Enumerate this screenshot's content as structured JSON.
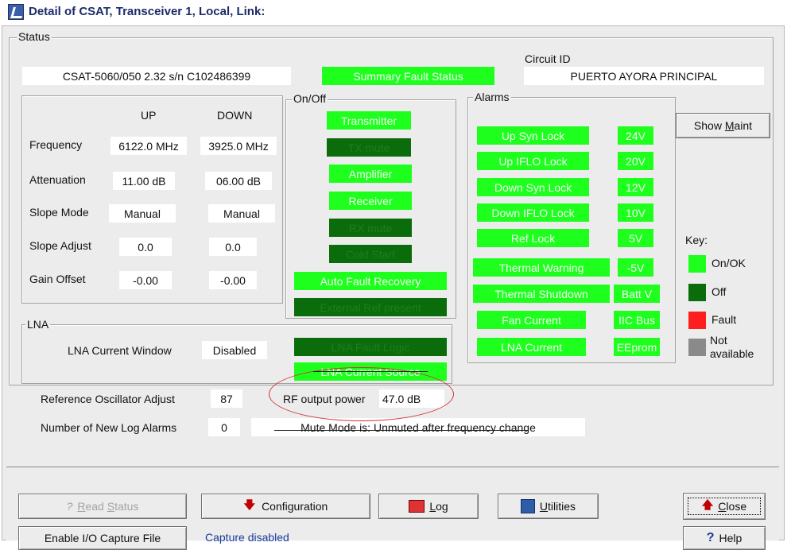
{
  "window": {
    "title": "Detail of CSAT,  Transceiver 1, Local, Link:"
  },
  "status": {
    "group_label": "Status",
    "device_info": "CSAT-5060/050  2.32   s/n C102486399",
    "summary_fault": "Summary Fault Status",
    "circuit_id_label": "Circuit ID",
    "circuit_id": "PUERTO AYORA PRINCIPAL"
  },
  "freq_table": {
    "col_up": "UP",
    "col_down": "DOWN",
    "rows": [
      {
        "label": "Frequency",
        "up": "6122.0 MHz",
        "down": "3925.0 MHz"
      },
      {
        "label": "Attenuation",
        "up": "11.00 dB",
        "down": "06.00 dB"
      },
      {
        "label": "Slope Mode",
        "up": "Manual",
        "down": "Manual"
      },
      {
        "label": "Slope Adjust",
        "up": "0.0",
        "down": "0.0"
      },
      {
        "label": "Gain Offset",
        "up": "-0.00",
        "down": "-0.00"
      }
    ]
  },
  "onoff": {
    "group_label": "On/Off",
    "items": [
      {
        "label": "Transmitter",
        "state": "on"
      },
      {
        "label": "TX mute",
        "state": "off"
      },
      {
        "label": "Amplifier",
        "state": "on"
      },
      {
        "label": "Receiver",
        "state": "on"
      },
      {
        "label": "RX mute",
        "state": "off"
      },
      {
        "label": "Cold Start",
        "state": "off"
      },
      {
        "label": "Auto Fault Recovery",
        "state": "on"
      },
      {
        "label": "External Ref present",
        "state": "off"
      }
    ]
  },
  "alarms": {
    "group_label": "Alarms",
    "left": [
      {
        "label": "Up Syn Lock",
        "state": "on"
      },
      {
        "label": "Up IFLO Lock",
        "state": "on"
      },
      {
        "label": "Down Syn Lock",
        "state": "on"
      },
      {
        "label": "Down IFLO Lock",
        "state": "on"
      },
      {
        "label": "Ref Lock",
        "state": "on"
      },
      {
        "label": "Thermal Warning",
        "state": "on"
      },
      {
        "label": "Thermal Shutdown",
        "state": "on"
      },
      {
        "label": "Fan Current",
        "state": "on"
      },
      {
        "label": "LNA Current",
        "state": "on"
      }
    ],
    "right": [
      {
        "label": "24V",
        "state": "on"
      },
      {
        "label": "20V",
        "state": "on"
      },
      {
        "label": "12V",
        "state": "on"
      },
      {
        "label": "10V",
        "state": "on"
      },
      {
        "label": "5V",
        "state": "on"
      },
      {
        "label": "-5V",
        "state": "on"
      },
      {
        "label": "Batt V",
        "state": "on"
      },
      {
        "label": "IIC Bus",
        "state": "on"
      },
      {
        "label": "EEprom",
        "state": "on"
      }
    ]
  },
  "show_maint": {
    "pre": "Show ",
    "ul": "M",
    "post": "aint"
  },
  "key": {
    "title": "Key:",
    "items": [
      {
        "label": "On/OK",
        "color": "#1eff1e"
      },
      {
        "label": "Off",
        "color": "#0a6c0a"
      },
      {
        "label": "Fault",
        "color": "#ff1e1e"
      },
      {
        "label": "Not",
        "label2": "available",
        "color": "#8a8a8a"
      }
    ]
  },
  "lna": {
    "group_label": "LNA",
    "current_window_label": "LNA Current Window",
    "current_window_value": "Disabled",
    "fault_logic": "LNA Fault Logic",
    "current_source": "LNA Current Source"
  },
  "ref_osc": {
    "label": "Reference Oscillator Adjust",
    "value": "87"
  },
  "rf_output": {
    "label": "RF output power",
    "value": "47.0 dB"
  },
  "log_alarms": {
    "label": "Number of New Log Alarms",
    "value": "0"
  },
  "mute_mode": "Mute Mode is: Unmuted after frequency change",
  "buttons": {
    "read_status": {
      "ul": "R",
      "rest": "ead ",
      "ul2": "S",
      "rest2": "tatus"
    },
    "configuration": "Configuration",
    "log": {
      "ul": "L",
      "rest": "og"
    },
    "utilities": {
      "ul": "U",
      "rest": "tilities"
    },
    "close": {
      "ul": "C",
      "rest": "lose"
    },
    "enable_capture": "Enable I/O Capture File",
    "capture_status": "Capture disabled",
    "help": "Help"
  },
  "colors": {
    "on": "#1eff1e",
    "off": "#0a6c0a",
    "fault": "#ff1e1e",
    "na": "#8a8a8a",
    "annotation": "#d23232",
    "arrow": "#c00000"
  }
}
